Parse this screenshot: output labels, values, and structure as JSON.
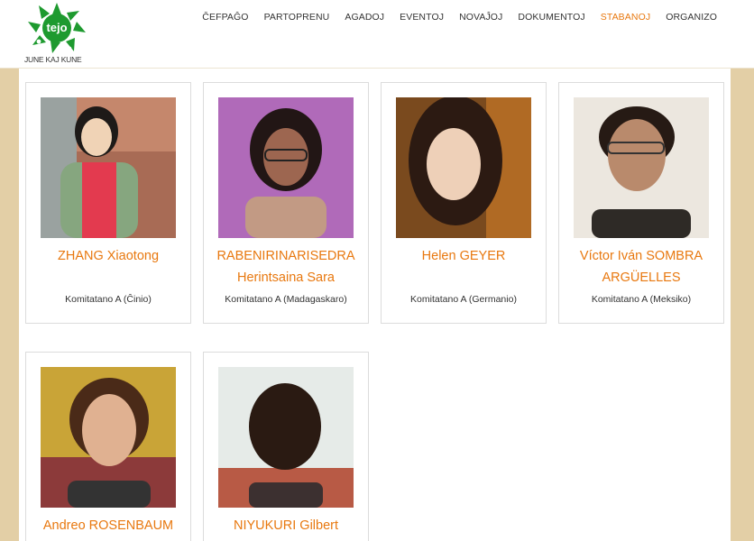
{
  "header": {
    "logo_text": "tejo",
    "logo_caption": "JUNE KAJ KUNE",
    "nav": [
      {
        "label": "ČEFPAĜO",
        "active": false
      },
      {
        "label": "PARTOPRENU",
        "active": false
      },
      {
        "label": "AGADOJ",
        "active": false
      },
      {
        "label": "EVENTOJ",
        "active": false
      },
      {
        "label": "NOVAĴOJ",
        "active": false
      },
      {
        "label": "DOKUMENTOJ",
        "active": false
      },
      {
        "label": "STABANOJ",
        "active": true
      },
      {
        "label": "ORGANIZO",
        "active": false
      }
    ]
  },
  "colors": {
    "accent": "#e8780f",
    "page_bg": "#e3cfa6",
    "logo_green": "#1e9a2f"
  },
  "people": [
    {
      "name": "ZHANG Xiaotong",
      "role": "Komitatano A (Ĉinio)"
    },
    {
      "name": "RABENIRINARISEDRA Herintsaina Sara",
      "role": "Komitatano A (Madagaskaro)"
    },
    {
      "name": "Helen GEYER",
      "role": "Komitatano A (Germanio)"
    },
    {
      "name": "Víctor Iván SOMBRA ARGÜELLES",
      "role": "Komitatano A (Meksiko)"
    },
    {
      "name": "Andreo ROSENBAUM",
      "role": ""
    },
    {
      "name": "NIYUKURI Gilbert",
      "role": ""
    }
  ]
}
